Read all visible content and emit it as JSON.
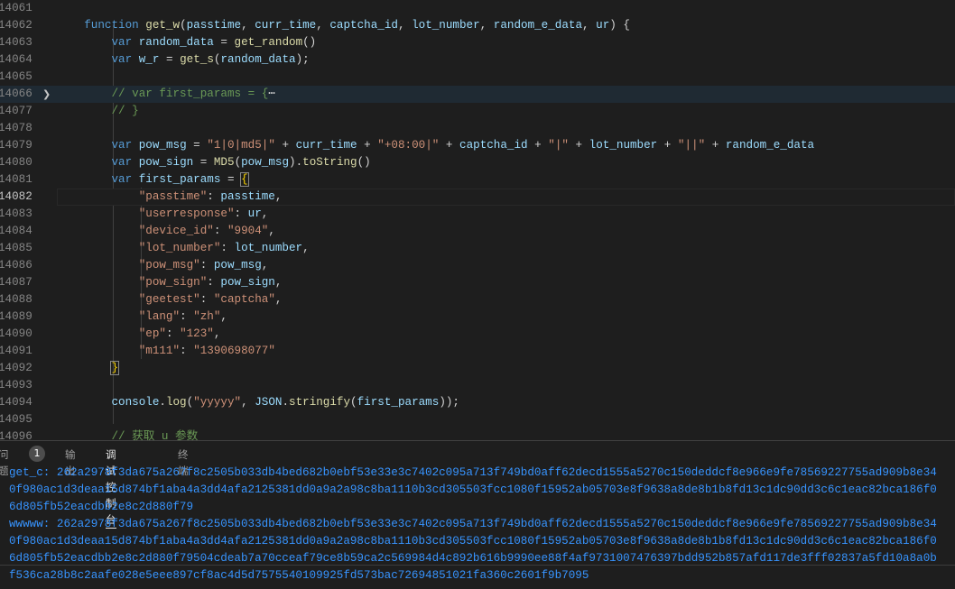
{
  "editor": {
    "current_line": "14082",
    "lines": [
      {
        "n": "14061",
        "t": []
      },
      {
        "n": "14062",
        "t": [
          [
            "p",
            "    "
          ],
          [
            "kw",
            "function"
          ],
          [
            "p",
            " "
          ],
          [
            "fn",
            "get_w"
          ],
          [
            "p",
            "("
          ],
          [
            "v",
            "passtime"
          ],
          [
            "p",
            ", "
          ],
          [
            "v",
            "curr_time"
          ],
          [
            "p",
            ", "
          ],
          [
            "v",
            "captcha_id"
          ],
          [
            "p",
            ", "
          ],
          [
            "v",
            "lot_number"
          ],
          [
            "p",
            ", "
          ],
          [
            "v",
            "random_e_data"
          ],
          [
            "p",
            ", "
          ],
          [
            "v",
            "ur"
          ],
          [
            "p",
            ") {"
          ]
        ]
      },
      {
        "n": "14063",
        "t": [
          [
            "p",
            "        "
          ],
          [
            "kw",
            "var"
          ],
          [
            "p",
            " "
          ],
          [
            "v",
            "random_data"
          ],
          [
            "p",
            " = "
          ],
          [
            "fn",
            "get_random"
          ],
          [
            "p",
            "()"
          ]
        ]
      },
      {
        "n": "14064",
        "t": [
          [
            "p",
            "        "
          ],
          [
            "kw",
            "var"
          ],
          [
            "p",
            " "
          ],
          [
            "v",
            "w_r"
          ],
          [
            "p",
            " = "
          ],
          [
            "fn",
            "get_s"
          ],
          [
            "p",
            "("
          ],
          [
            "v",
            "random_data"
          ],
          [
            "p",
            ");"
          ]
        ]
      },
      {
        "n": "14065",
        "t": []
      },
      {
        "n": "14066",
        "fold": true,
        "t": [
          [
            "p",
            "        "
          ],
          [
            "c",
            "// var first_params = {"
          ],
          [
            "p",
            "⋯"
          ]
        ]
      },
      {
        "n": "14077",
        "t": [
          [
            "p",
            "        "
          ],
          [
            "c",
            "// }"
          ]
        ]
      },
      {
        "n": "14078",
        "t": []
      },
      {
        "n": "14079",
        "t": [
          [
            "p",
            "        "
          ],
          [
            "kw",
            "var"
          ],
          [
            "p",
            " "
          ],
          [
            "v",
            "pow_msg"
          ],
          [
            "p",
            " = "
          ],
          [
            "s",
            "\"1|0|md5|\""
          ],
          [
            "p",
            " + "
          ],
          [
            "v",
            "curr_time"
          ],
          [
            "p",
            " + "
          ],
          [
            "s",
            "\"+08:00|\""
          ],
          [
            "p",
            " + "
          ],
          [
            "v",
            "captcha_id"
          ],
          [
            "p",
            " + "
          ],
          [
            "s",
            "\"|\""
          ],
          [
            "p",
            " + "
          ],
          [
            "v",
            "lot_number"
          ],
          [
            "p",
            " + "
          ],
          [
            "s",
            "\"||\""
          ],
          [
            "p",
            " + "
          ],
          [
            "v",
            "random_e_data"
          ]
        ]
      },
      {
        "n": "14080",
        "t": [
          [
            "p",
            "        "
          ],
          [
            "kw",
            "var"
          ],
          [
            "p",
            " "
          ],
          [
            "v",
            "pow_sign"
          ],
          [
            "p",
            " = "
          ],
          [
            "fn",
            "MD5"
          ],
          [
            "p",
            "("
          ],
          [
            "v",
            "pow_msg"
          ],
          [
            "p",
            ")."
          ],
          [
            "fn",
            "toString"
          ],
          [
            "p",
            "()"
          ]
        ]
      },
      {
        "n": "14081",
        "t": [
          [
            "p",
            "        "
          ],
          [
            "kw",
            "var"
          ],
          [
            "p",
            " "
          ],
          [
            "v",
            "first_params"
          ],
          [
            "p",
            " = "
          ],
          [
            "bm",
            "{"
          ]
        ]
      },
      {
        "n": "14082",
        "t": [
          [
            "p",
            "            "
          ],
          [
            "s",
            "\"passtime\""
          ],
          [
            "p",
            ": "
          ],
          [
            "v",
            "passtime"
          ],
          [
            "p",
            ","
          ]
        ]
      },
      {
        "n": "14083",
        "t": [
          [
            "p",
            "            "
          ],
          [
            "s",
            "\"userresponse\""
          ],
          [
            "p",
            ": "
          ],
          [
            "v",
            "ur"
          ],
          [
            "p",
            ","
          ]
        ]
      },
      {
        "n": "14084",
        "t": [
          [
            "p",
            "            "
          ],
          [
            "s",
            "\"device_id\""
          ],
          [
            "p",
            ": "
          ],
          [
            "s",
            "\"9904\""
          ],
          [
            "p",
            ","
          ]
        ]
      },
      {
        "n": "14085",
        "t": [
          [
            "p",
            "            "
          ],
          [
            "s",
            "\"lot_number\""
          ],
          [
            "p",
            ": "
          ],
          [
            "v",
            "lot_number"
          ],
          [
            "p",
            ","
          ]
        ]
      },
      {
        "n": "14086",
        "t": [
          [
            "p",
            "            "
          ],
          [
            "s",
            "\"pow_msg\""
          ],
          [
            "p",
            ": "
          ],
          [
            "v",
            "pow_msg"
          ],
          [
            "p",
            ","
          ]
        ]
      },
      {
        "n": "14087",
        "t": [
          [
            "p",
            "            "
          ],
          [
            "s",
            "\"pow_sign\""
          ],
          [
            "p",
            ": "
          ],
          [
            "v",
            "pow_sign"
          ],
          [
            "p",
            ","
          ]
        ]
      },
      {
        "n": "14088",
        "t": [
          [
            "p",
            "            "
          ],
          [
            "s",
            "\"geetest\""
          ],
          [
            "p",
            ": "
          ],
          [
            "s",
            "\"captcha\""
          ],
          [
            "p",
            ","
          ]
        ]
      },
      {
        "n": "14089",
        "t": [
          [
            "p",
            "            "
          ],
          [
            "s",
            "\"lang\""
          ],
          [
            "p",
            ": "
          ],
          [
            "s",
            "\"zh\""
          ],
          [
            "p",
            ","
          ]
        ]
      },
      {
        "n": "14090",
        "t": [
          [
            "p",
            "            "
          ],
          [
            "s",
            "\"ep\""
          ],
          [
            "p",
            ": "
          ],
          [
            "s",
            "\"123\""
          ],
          [
            "p",
            ","
          ]
        ]
      },
      {
        "n": "14091",
        "t": [
          [
            "p",
            "            "
          ],
          [
            "s",
            "\"m111\""
          ],
          [
            "p",
            ": "
          ],
          [
            "s",
            "\"1390698077\""
          ]
        ]
      },
      {
        "n": "14092",
        "t": [
          [
            "p",
            "        "
          ],
          [
            "bm",
            "}"
          ]
        ]
      },
      {
        "n": "14093",
        "t": []
      },
      {
        "n": "14094",
        "t": [
          [
            "p",
            "        "
          ],
          [
            "v",
            "console"
          ],
          [
            "p",
            "."
          ],
          [
            "fn",
            "log"
          ],
          [
            "p",
            "("
          ],
          [
            "s",
            "\"yyyyy\""
          ],
          [
            "p",
            ", "
          ],
          [
            "v",
            "JSON"
          ],
          [
            "p",
            "."
          ],
          [
            "fn",
            "stringify"
          ],
          [
            "p",
            "("
          ],
          [
            "v",
            "first_params"
          ],
          [
            "p",
            "));"
          ]
        ]
      },
      {
        "n": "14095",
        "t": []
      },
      {
        "n": "14096",
        "t": [
          [
            "p",
            "        "
          ],
          [
            "c",
            "// 获取 u 参数"
          ]
        ]
      }
    ]
  },
  "panel": {
    "tabs": [
      {
        "label": "问题"
      },
      {
        "label": "输出"
      },
      {
        "label": "调试控制台",
        "active": true
      },
      {
        "label": "终端"
      }
    ],
    "problems_count": "1",
    "output": [
      "get_c: 262a2978f3da675a267f8c2505b033db4bed682b0ebf53e33e3c7402c095a713f749bd0aff62decd1555a5270c150deddcf8e966e9fe78569227755ad909b8e34",
      "0f980ac1d3deaa15d874bf1aba4a3dd4afa2125381dd0a9a2a98c8ba1110b3cd305503fcc1080f15952ab05703e8f9638a8de8b1b8fd13c1dc90dd3c6c1eac82bca186f0",
      "6d805fb52eacdbb2e8c2d880f79",
      "wwwww: 262a2978f3da675a267f8c2505b033db4bed682b0ebf53e33e3c7402c095a713f749bd0aff62decd1555a5270c150deddcf8e966e9fe78569227755ad909b8e34",
      "0f980ac1d3deaa15d874bf1aba4a3dd4afa2125381dd0a9a2a98c8ba1110b3cd305503fcc1080f15952ab05703e8f9638a8de8b1b8fd13c1dc90dd3c6c1eac82bca186f0",
      "6d805fb52eacdbb2e8c2d880f79504cdeab7a70cceaf79ce8b59ca2c569984d4c892b616b9990ee88f4af9731007476397bdd952b857afd117de3fff02837a5fd10a8a0b",
      "f536ca28b8c2aafe028e5eee897cf8ac4d5d7575540109925fd573bac72694851021fa360c2601f9b7095"
    ]
  },
  "colors": {
    "keyword": "#569cd6",
    "function": "#dcdcaa",
    "variable": "#9cdcfe",
    "string": "#ce9178",
    "comment": "#6a9955",
    "console_output": "#3794ff"
  }
}
